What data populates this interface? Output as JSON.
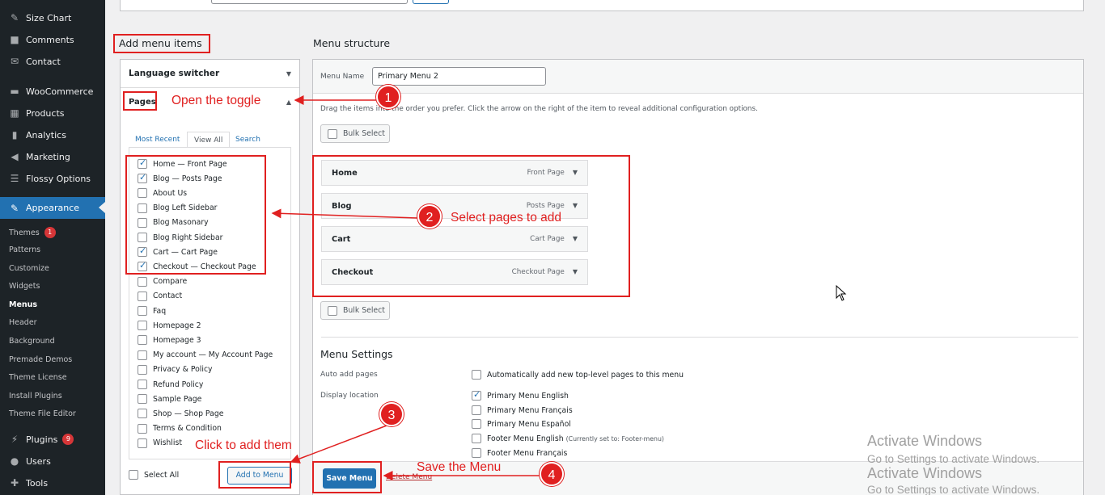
{
  "sidebar": {
    "items": [
      {
        "label": "Size Chart",
        "icon": "brush-icon"
      },
      {
        "label": "Comments",
        "icon": "comment-icon"
      },
      {
        "label": "Contact",
        "icon": "mail-icon"
      },
      {
        "label": "WooCommerce",
        "icon": "woo-icon"
      },
      {
        "label": "Products",
        "icon": "archive-icon"
      },
      {
        "label": "Analytics",
        "icon": "chart-icon"
      },
      {
        "label": "Marketing",
        "icon": "megaphone-icon"
      },
      {
        "label": "Flossy Options",
        "icon": "list-icon"
      },
      {
        "label": "Appearance",
        "icon": "brush-icon"
      }
    ],
    "appearance_sub": [
      {
        "label": "Themes",
        "badge": "1"
      },
      {
        "label": "Patterns"
      },
      {
        "label": "Customize"
      },
      {
        "label": "Widgets"
      },
      {
        "label": "Menus"
      },
      {
        "label": "Header"
      },
      {
        "label": "Background"
      },
      {
        "label": "Premade Demos"
      },
      {
        "label": "Theme License"
      },
      {
        "label": "Install Plugins"
      },
      {
        "label": "Theme File Editor"
      }
    ],
    "bottom": [
      {
        "label": "Plugins",
        "badge": "9",
        "icon": "plug-icon"
      },
      {
        "label": "Users",
        "icon": "user-icon"
      },
      {
        "label": "Tools",
        "icon": "wrench-icon"
      }
    ]
  },
  "left": {
    "heading": "Add menu items",
    "language_switcher": "Language switcher",
    "pages_label": "Pages",
    "tabs": [
      "Most Recent",
      "View All",
      "Search"
    ],
    "pages": [
      {
        "label": "Home — Front Page",
        "checked": true
      },
      {
        "label": "Blog — Posts Page",
        "checked": true
      },
      {
        "label": "About Us",
        "checked": false
      },
      {
        "label": "Blog Left Sidebar",
        "checked": false
      },
      {
        "label": "Blog Masonary",
        "checked": false
      },
      {
        "label": "Blog Right Sidebar",
        "checked": false
      },
      {
        "label": "Cart — Cart Page",
        "checked": true
      },
      {
        "label": "Checkout — Checkout Page",
        "checked": true
      },
      {
        "label": "Compare",
        "checked": false
      },
      {
        "label": "Contact",
        "checked": false
      },
      {
        "label": "Faq",
        "checked": false
      },
      {
        "label": "Homepage 2",
        "checked": false
      },
      {
        "label": "Homepage 3",
        "checked": false
      },
      {
        "label": "My account — My Account Page",
        "checked": false
      },
      {
        "label": "Privacy & Policy",
        "checked": false
      },
      {
        "label": "Refund Policy",
        "checked": false
      },
      {
        "label": "Sample Page",
        "checked": false
      },
      {
        "label": "Shop — Shop Page",
        "checked": false
      },
      {
        "label": "Terms & Condition",
        "checked": false
      },
      {
        "label": "Wishlist",
        "checked": false
      }
    ],
    "select_all": "Select All",
    "add_to_menu": "Add to Menu"
  },
  "right": {
    "heading": "Menu structure",
    "menu_name_label": "Menu Name",
    "menu_name_value": "Primary Menu 2",
    "instructions": "Drag the items into the order you prefer. Click the arrow on the right of the item to reveal additional configuration options.",
    "bulk_select": "Bulk Select",
    "items": [
      {
        "title": "Home",
        "type": "Front Page"
      },
      {
        "title": "Blog",
        "type": "Posts Page"
      },
      {
        "title": "Cart",
        "type": "Cart Page"
      },
      {
        "title": "Checkout",
        "type": "Checkout Page"
      }
    ],
    "settings_heading": "Menu Settings",
    "auto_add_label": "Auto add pages",
    "auto_add_option": "Automatically add new top-level pages to this menu",
    "display_location_label": "Display location",
    "locations": [
      {
        "label": "Primary Menu English",
        "checked": true,
        "note": ""
      },
      {
        "label": "Primary Menu Français",
        "checked": false,
        "note": ""
      },
      {
        "label": "Primary Menu Español",
        "checked": false,
        "note": ""
      },
      {
        "label": "Footer Menu English",
        "checked": false,
        "note": "(Currently set to: Footer-menu)"
      },
      {
        "label": "Footer Menu Français",
        "checked": false,
        "note": ""
      }
    ],
    "save_menu": "Save Menu",
    "delete_menu": "Delete Menu"
  },
  "annotations": {
    "open_toggle": "Open the toggle",
    "select_pages": "Select pages to add",
    "click_add": "Click to add them",
    "save_menu": "Save the Menu",
    "steps": [
      "1",
      "2",
      "3",
      "4"
    ]
  },
  "watermark": {
    "title": "Activate Windows",
    "subtitle": "Go to Settings to activate Windows."
  },
  "colors": {
    "accent": "#2271b1",
    "annotation": "#e02020",
    "admin_bg": "#1d2327"
  }
}
